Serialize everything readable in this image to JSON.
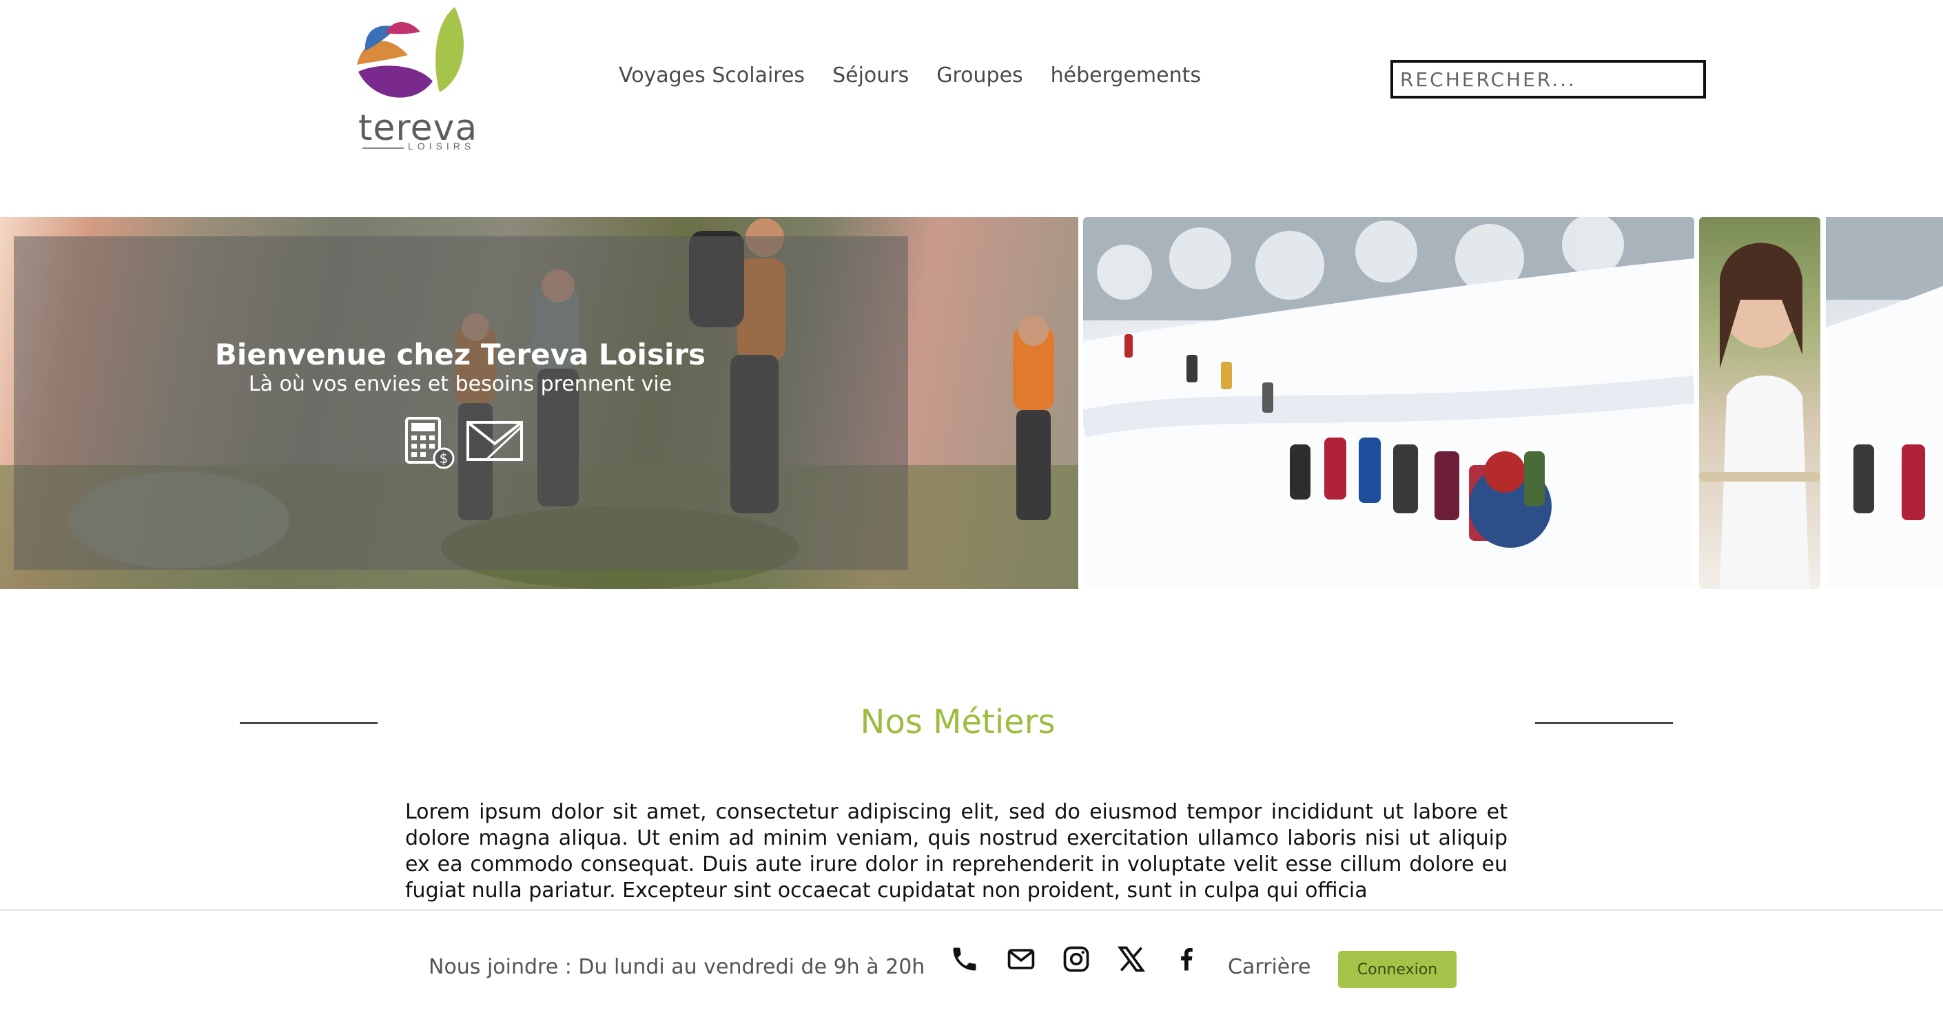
{
  "brand": {
    "name": "tereva",
    "tagline": "LOISIRS"
  },
  "nav": {
    "items": [
      "Voyages Scolaires",
      "Séjours",
      "Groupes",
      "hébergements"
    ]
  },
  "search": {
    "placeholder": "RECHERCHER..."
  },
  "hero": {
    "title": "Bienvenue chez Tereva Loisirs",
    "subtitle": "Là où vos envies et besoins prennent vie",
    "icons": [
      "calculator-dollar-icon",
      "envelope-icon"
    ]
  },
  "section": {
    "title": "Nos Métiers",
    "body": "Lorem ipsum dolor sit amet, consectetur adipiscing elit, sed do eiusmod tempor incididunt ut labore et dolore magna aliqua. Ut enim ad minim veniam, quis nostrud exercitation ullamco laboris nisi ut aliquip ex ea commodo consequat. Duis aute irure dolor in reprehenderit in voluptate velit esse cillum dolore eu fugiat nulla pariatur. Excepteur sint occaecat cupidatat non proident, sunt in culpa qui officia"
  },
  "footer": {
    "contact": "Nous joindre : Du lundi au vendredi de 9h à 20h",
    "icons": [
      "phone-icon",
      "mail-icon",
      "instagram-icon",
      "x-icon",
      "facebook-icon"
    ],
    "career": "Carrière",
    "login": "Connexion"
  },
  "colors": {
    "accent_green": "#9dbd3f",
    "button_green": "#a3c349",
    "logo_purple": "#7a2a8c",
    "logo_orange": "#d98a3c",
    "logo_blue": "#3b6fb6"
  }
}
